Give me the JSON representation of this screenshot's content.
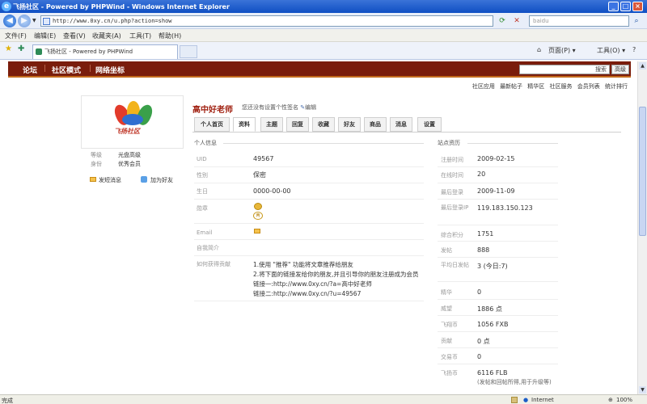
{
  "window": {
    "title": "飞扬社区 - Powered by PHPWind - Windows Internet Explorer"
  },
  "address": {
    "url": "http://www.0xy.cn/u.php?action=show",
    "search_placeholder": "baidu"
  },
  "menu": [
    "文件(F)",
    "编辑(E)",
    "查看(V)",
    "收藏夹(A)",
    "工具(T)",
    "帮助(H)"
  ],
  "tab": {
    "title": "飞扬社区 - Powered by PHPWind"
  },
  "toolbar": {
    "page": "页面(P)",
    "tools": "工具(O)"
  },
  "forum_nav": [
    "论坛",
    "社区模式",
    "网络坐标"
  ],
  "forum_search": {
    "value": "搜索",
    "button": "高级"
  },
  "sublinks": [
    "社区应用",
    "最新帖子",
    "精华区",
    "社区服务",
    "会员列表",
    "统计排行"
  ],
  "profile": {
    "logo_text": "飞扬社区",
    "level_label": "等级",
    "level_value": "光盘高级",
    "identity_label": "身份",
    "identity_value": "优秀会员",
    "send_msg": "发短消息",
    "add_friend": "加为好友",
    "username": "高中好老师",
    "signature": "您还没有设置个性签名",
    "edit": "编辑"
  },
  "tabs": [
    "个人首页",
    "资料",
    "主题",
    "回复",
    "收藏",
    "好友",
    "商品",
    "消息",
    "设置"
  ],
  "personal": {
    "title": "个人信息",
    "rows": [
      {
        "label": "UID",
        "value": "49567"
      },
      {
        "label": "性别",
        "value": "保密"
      },
      {
        "label": "生日",
        "value": "0000-00-00"
      },
      {
        "label": "勋章",
        "value": "两"
      },
      {
        "label": "Email",
        "value": ""
      },
      {
        "label": "自我简介",
        "value": ""
      },
      {
        "label": "如何获得贡献",
        "value": ""
      }
    ],
    "contrib_lines": [
      "1.使用 \"推荐\" 功能将文章推荐给朋友",
      "2.将下面的链接发给你的朋友,并且引导你的朋友注册成为会员",
      "链接一:http://www.0xy.cn/?a=高中好老师",
      "链接二:http://www.0xy.cn/?u=49567"
    ]
  },
  "site": {
    "title": "站点资历",
    "rows": [
      {
        "label": "注册时间",
        "value": "2009-02-15"
      },
      {
        "label": "在线时间",
        "value": "20"
      },
      {
        "label": "最后登录",
        "value": "2009-11-09"
      },
      {
        "label": "最后登录IP",
        "value": "119.183.150.123"
      },
      {
        "label": "综合积分",
        "value": "1751"
      },
      {
        "label": "发帖",
        "value": "888"
      },
      {
        "label": "平均日发帖",
        "value": "3 (今日:7)"
      },
      {
        "label": "精华",
        "value": "0"
      },
      {
        "label": "威望",
        "value": "1886 点"
      },
      {
        "label": "飞翔币",
        "value": "1056 FXB"
      },
      {
        "label": "贡献",
        "value": "0 点"
      },
      {
        "label": "交易币",
        "value": "0"
      },
      {
        "label": "飞扬币",
        "value": "6116 FLB"
      }
    ],
    "flb_note": "(发帖和回帖所得,用于升级等)"
  },
  "status": {
    "left": "完成",
    "zone": "Internet",
    "zoom": "100%"
  }
}
